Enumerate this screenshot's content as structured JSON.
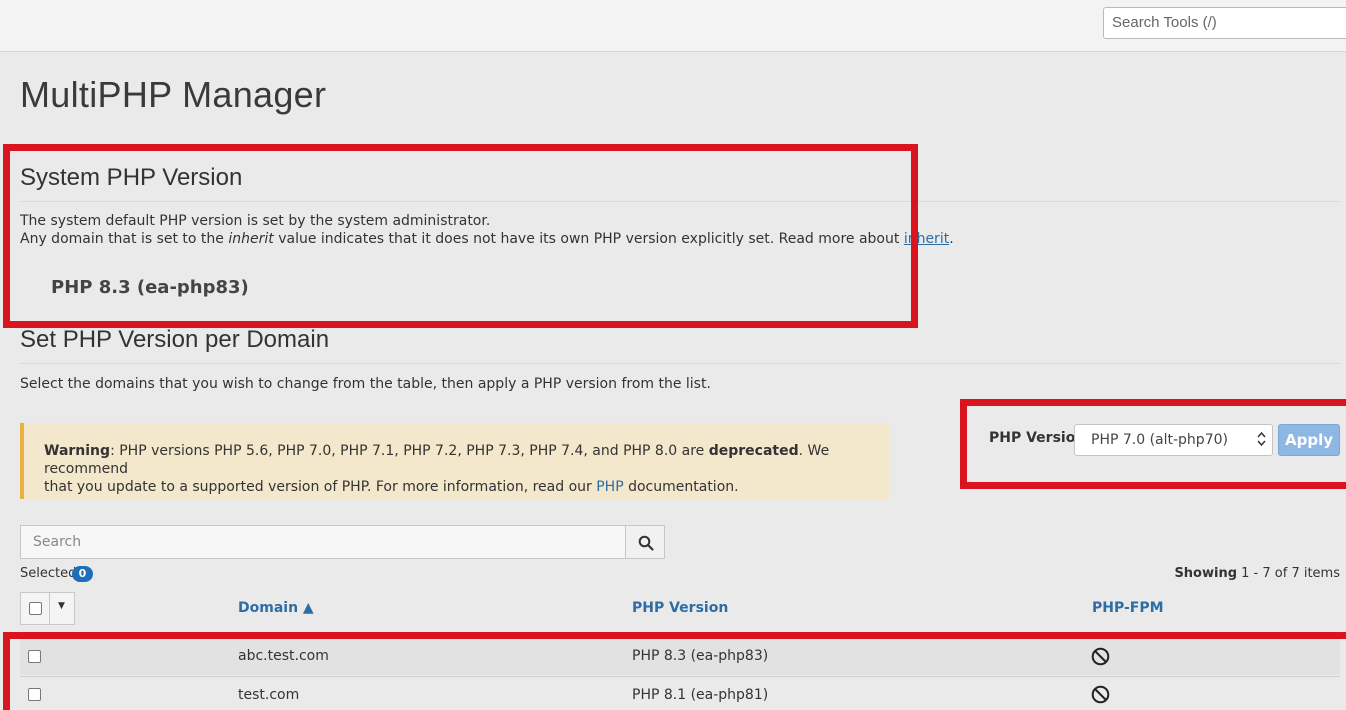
{
  "header": {
    "search_placeholder": "Search Tools (/)"
  },
  "page_title": "MultiPHP Manager",
  "system_section": {
    "heading": "System PHP Version",
    "line1": "The system default PHP version is set by the system administrator.",
    "line2_prefix": "Any domain that is set to the ",
    "line2_em": "inherit",
    "line2_middle": " value indicates that it does not have its own PHP version explicitly set. Read more about ",
    "line2_link": "inherit",
    "line2_suffix": ".",
    "version": "PHP 8.3 (ea-php83)"
  },
  "domain_section": {
    "heading": "Set PHP Version per Domain",
    "description": "Select the domains that you wish to change from the table, then apply a PHP version from the list."
  },
  "warning": {
    "label": "Warning",
    "text1": ": PHP versions PHP 5.6, PHP 7.0, PHP 7.1, PHP 7.2, PHP 7.3, PHP 7.4, and PHP 8.0 are ",
    "deprecated": "deprecated",
    "text2": ". We recommend",
    "text3": "that you update to a supported version of PHP. For more information, read our ",
    "link": "PHP",
    "text4": " documentation."
  },
  "version_picker": {
    "label": "PHP Version",
    "selected": "PHP 7.0 (alt-php70)",
    "apply_label": "Apply"
  },
  "table_search": {
    "placeholder": "Search"
  },
  "selection": {
    "label": "Selected",
    "count": "0"
  },
  "pagination": {
    "prefix": "Showing",
    "range": " 1 - 7 of 7 items"
  },
  "table": {
    "columns": [
      "Domain ▲",
      "PHP Version",
      "PHP-FPM"
    ],
    "rows": [
      {
        "domain": "abc.test.com",
        "php_version": "PHP 8.3 (ea-php83)",
        "fpm_icon": "disabled-icon"
      },
      {
        "domain": "test.com",
        "php_version": "PHP 8.1 (ea-php81)",
        "fpm_icon": "disabled-icon"
      }
    ]
  },
  "colors": {
    "highlight": "#d9141f",
    "link": "#2e6da4",
    "badge": "#1f6fb8",
    "warning_bg": "#f3e7cc",
    "warning_border": "#e6b23d",
    "apply_button": "#8fb7e3"
  }
}
